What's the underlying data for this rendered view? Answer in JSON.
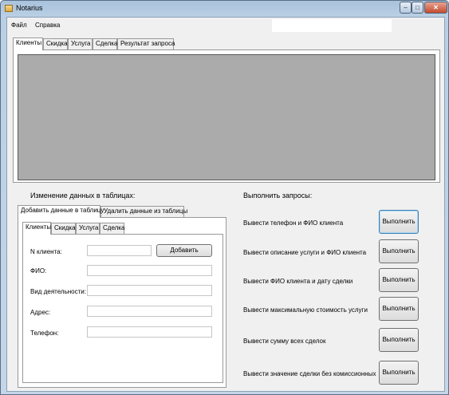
{
  "window": {
    "title": "Notarius",
    "minimize": "–",
    "maximize": "□",
    "close": "✕"
  },
  "menu": {
    "file": "Файл",
    "help": "Справка"
  },
  "top_tabs": [
    "Клиенты",
    "Скидка",
    "Услуга",
    "Сделка",
    "Результат запроса"
  ],
  "edit_section": {
    "title": "Изменение данных в таблицах:",
    "tabs": [
      "Добавить данные в таблицу",
      "Удалить данные из таблицы"
    ],
    "inner_tabs": [
      "Клиенты",
      "Скидка",
      "Услуга",
      "Сделка"
    ],
    "fields": {
      "client_no": {
        "label": "N клиента:",
        "value": ""
      },
      "fio": {
        "label": "ФИО:",
        "value": ""
      },
      "activity": {
        "label": "Вид деятельности:",
        "value": ""
      },
      "address": {
        "label": "Адрес:",
        "value": ""
      },
      "phone": {
        "label": "Телефон:",
        "value": ""
      }
    },
    "add_button": "Добавить"
  },
  "queries": {
    "title": "Выполнить запросы:",
    "execute_label": "Выполнить",
    "items": [
      "Вывести телефон и ФИО клиента",
      "Вывести описание услуги и ФИО клиента",
      "Вывести ФИО клиента и дату сделки",
      "Вывести максимальную стоимость услуги",
      "Вывести сумму всех сделок",
      "Вывести значение сделки без комиссионных"
    ]
  }
}
